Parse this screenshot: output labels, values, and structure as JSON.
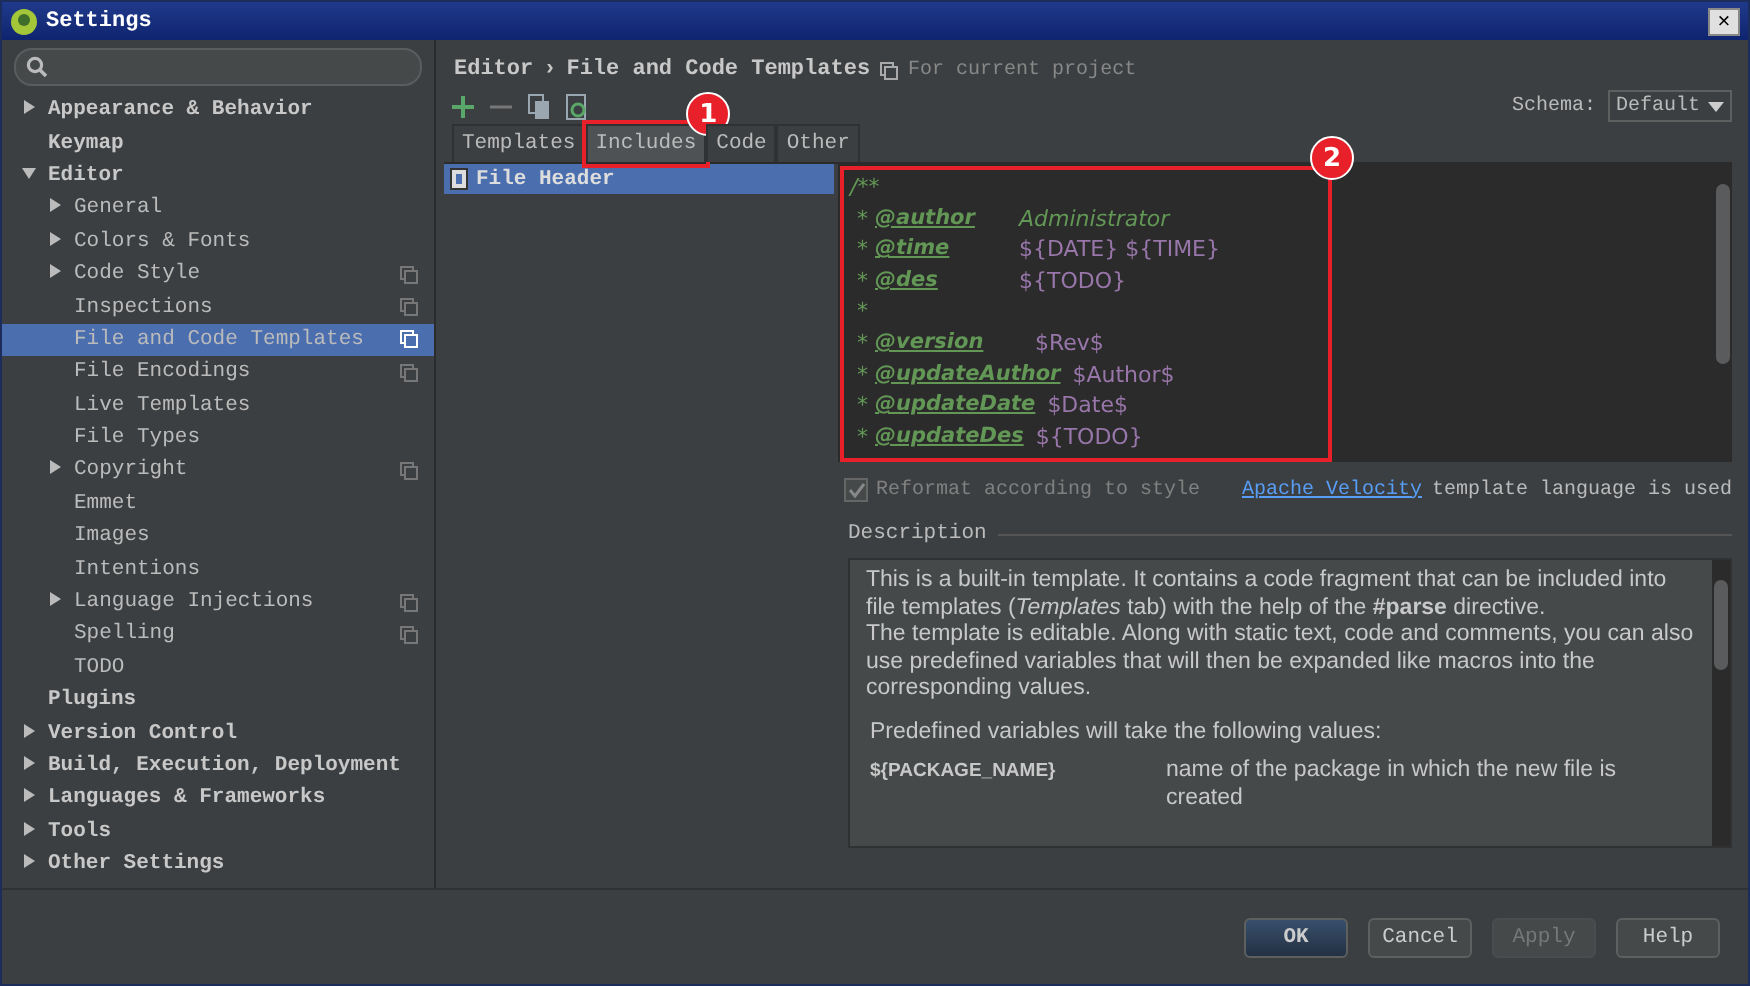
{
  "window": {
    "title": "Settings",
    "close": "×"
  },
  "sidebar": {
    "items": [
      {
        "label": "Appearance & Behavior",
        "expanded": false,
        "selected": false
      },
      {
        "label": "Keymap",
        "selected": false
      },
      {
        "label": "Editor",
        "expanded": true,
        "selected": false,
        "children": [
          {
            "label": "General",
            "expanded": false,
            "selected": false
          },
          {
            "label": "Colors & Fonts",
            "expanded": false,
            "selected": false
          },
          {
            "label": "Code Style",
            "expanded": false,
            "selected": false,
            "project_icon": true
          },
          {
            "label": "Inspections",
            "selected": false,
            "project_icon": true
          },
          {
            "label": "File and Code Templates",
            "selected": true,
            "project_icon": true
          },
          {
            "label": "File Encodings",
            "selected": false,
            "project_icon": true
          },
          {
            "label": "Live Templates",
            "selected": false
          },
          {
            "label": "File Types",
            "selected": false
          },
          {
            "label": "Copyright",
            "expanded": false,
            "selected": false,
            "project_icon": true
          },
          {
            "label": "Emmet",
            "selected": false
          },
          {
            "label": "Images",
            "selected": false
          },
          {
            "label": "Intentions",
            "selected": false
          },
          {
            "label": "Language Injections",
            "expanded": false,
            "selected": false,
            "project_icon": true
          },
          {
            "label": "Spelling",
            "selected": false,
            "project_icon": true
          },
          {
            "label": "TODO",
            "selected": false
          }
        ]
      },
      {
        "label": "Plugins",
        "selected": false
      },
      {
        "label": "Version Control",
        "expanded": false,
        "selected": false
      },
      {
        "label": "Build, Execution, Deployment",
        "expanded": false,
        "selected": false
      },
      {
        "label": "Languages & Frameworks",
        "expanded": false,
        "selected": false
      },
      {
        "label": "Tools",
        "expanded": false,
        "selected": false
      },
      {
        "label": "Other Settings",
        "expanded": false,
        "selected": false
      }
    ]
  },
  "breadcrumb": {
    "parent": "Editor",
    "separator": "›",
    "current": "File and Code Templates",
    "scope": "For current project"
  },
  "schema": {
    "label": "Schema:",
    "value": "Default"
  },
  "tabs": [
    {
      "label": "Templates",
      "selected": false
    },
    {
      "label": "Includes",
      "selected": true,
      "callout": "1"
    },
    {
      "label": "Code",
      "selected": false
    },
    {
      "label": "Other",
      "selected": false
    }
  ],
  "template_list": [
    {
      "label": "File Header",
      "selected": true
    }
  ],
  "editor": {
    "callout": "2",
    "lines": [
      {
        "kind": "open",
        "text": "/**"
      },
      {
        "kind": "tag-comment",
        "star": "*",
        "tag": "@author",
        "value": "Administrator"
      },
      {
        "kind": "tag-variable",
        "star": "*",
        "tag": "@time",
        "value": "${DATE} ${TIME}"
      },
      {
        "kind": "tag-variable",
        "star": "*",
        "tag": "@des",
        "value": "${TODO}"
      },
      {
        "kind": "star",
        "star": "*"
      },
      {
        "kind": "tag-variable",
        "star": "*",
        "tag": "@version",
        "value": "$Rev$"
      },
      {
        "kind": "tag-variable",
        "star": "*",
        "tag": "@updateAuthor",
        "value": "$Author$"
      },
      {
        "kind": "tag-variable",
        "star": "*",
        "tag": "@updateDate",
        "value": "$Date$"
      },
      {
        "kind": "tag-variable",
        "star": "*",
        "tag": "@updateDes",
        "value": "${TODO}"
      }
    ]
  },
  "reformat": {
    "label": "Reformat according to style",
    "checked": true,
    "disabled": true
  },
  "velocity": {
    "link": "Apache Velocity",
    "text": "template language is used"
  },
  "description": {
    "title": "Description",
    "paragraphs": [
      "This is a built-in template. It contains a code fragment that can be included into file templates (*Templates* tab) with the help of the **#parse** directive.",
      "The template is editable. Along with static text, code and comments, you can also use predefined variables that will then be expanded like macros into the corresponding values."
    ],
    "variables_intro": "Predefined variables will take the following values:",
    "variables": [
      {
        "name": "${PACKAGE_NAME}",
        "meaning": "name of the package in which the new file is created"
      }
    ]
  },
  "buttons": [
    {
      "label": "OK",
      "default": true,
      "disabled": false
    },
    {
      "label": "Cancel",
      "default": false,
      "disabled": false
    },
    {
      "label": "Apply",
      "default": false,
      "disabled": true
    },
    {
      "label": "Help",
      "default": false,
      "disabled": false
    }
  ]
}
